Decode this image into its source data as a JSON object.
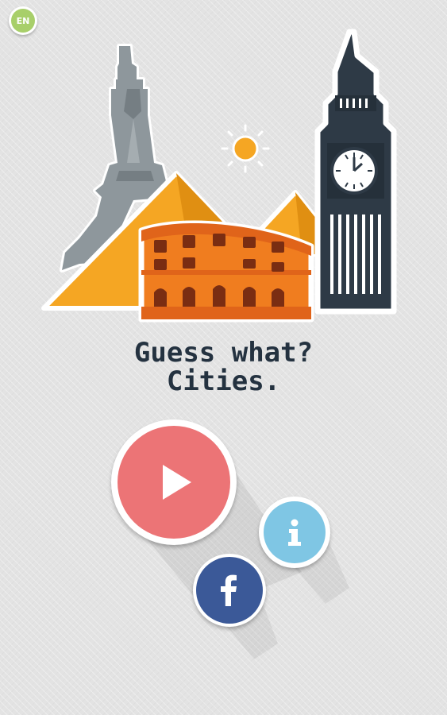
{
  "language": {
    "code": "EN"
  },
  "title": {
    "line1": "Guess what?",
    "line2": "Cities."
  },
  "buttons": {
    "play": {
      "icon": "play-icon"
    },
    "info": {
      "icon": "info-icon"
    },
    "facebook": {
      "icon": "facebook-icon"
    }
  },
  "colors": {
    "background": "#e3e3e3",
    "title": "#243240",
    "play": "#ec7476",
    "info": "#7fc6e4",
    "facebook": "#3b5998",
    "language": "#a8cf6a",
    "pyramid": "#f5a623",
    "colosseum": "#f07d1f",
    "eiffel": "#8e979c",
    "bigben": "#2e3a46"
  }
}
